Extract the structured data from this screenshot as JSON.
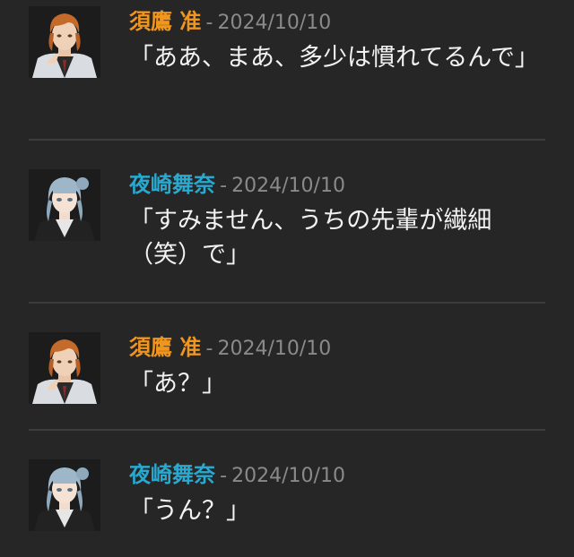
{
  "messages": [
    {
      "author": "須鷹 准",
      "author_color": "#f0961e",
      "separator": "-",
      "date": "2024/10/10",
      "text": "「ああ、まあ、多少は慣れてるんで」",
      "avatar_icon": "orange-hair-man-avatar"
    },
    {
      "author": "夜崎舞奈",
      "author_color": "#29a9cf",
      "separator": "-",
      "date": "2024/10/10",
      "text": "「すみません、うちの先輩が繊細（笑）で」",
      "avatar_icon": "blue-hair-woman-avatar"
    },
    {
      "author": "須鷹 准",
      "author_color": "#f0961e",
      "separator": "-",
      "date": "2024/10/10",
      "text": "「あ？」",
      "avatar_icon": "orange-hair-man-avatar"
    },
    {
      "author": "夜崎舞奈",
      "author_color": "#29a9cf",
      "separator": "-",
      "date": "2024/10/10",
      "text": "「うん？」",
      "avatar_icon": "blue-hair-woman-avatar"
    }
  ]
}
